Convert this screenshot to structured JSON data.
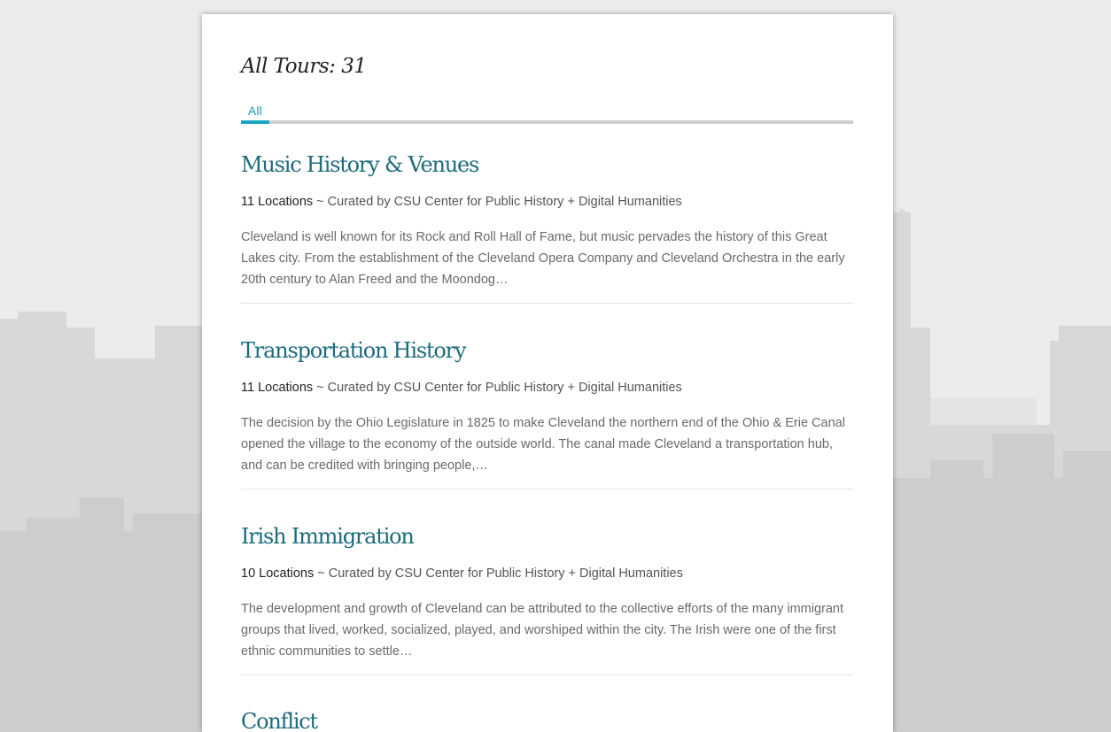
{
  "page": {
    "title": "All Tours: 31"
  },
  "tabs": [
    {
      "label": "All",
      "active": true
    }
  ],
  "colors": {
    "accent": "#17a5c6",
    "title_link": "#1c6b7d",
    "background": "#ececec",
    "skyline": "#d9d9d9"
  },
  "tours": [
    {
      "title": "Music History & Venues",
      "count": "11 Locations",
      "curator": " ~ Curated by CSU Center for Public History + Digital Humanities",
      "description": "Cleveland is well known for its Rock and Roll Hall of Fame, but music pervades the history of this Great Lakes city. From the establishment of the Cleveland Opera Company and Cleveland Orchestra in the early 20th century to Alan Freed and the Moondog…"
    },
    {
      "title": "Transportation History",
      "count": "11 Locations",
      "curator": " ~ Curated by CSU Center for Public History + Digital Humanities",
      "description": "The decision by the Ohio Legislature in 1825 to make Cleveland the northern end of the Ohio & Erie Canal opened the village to the economy of the outside world. The canal made Cleveland a transportation hub, and can be credited with bringing people,…"
    },
    {
      "title": "Irish Immigration",
      "count": "10 Locations",
      "curator": " ~ Curated by CSU Center for Public History + Digital Humanities",
      "description": "The development and growth of Cleveland can be attributed to the collective efforts of the many immigrant groups that lived, worked, socialized, played, and worshiped within the city. The Irish were one of the first ethnic communities to settle…"
    },
    {
      "title": "Conflict"
    }
  ]
}
